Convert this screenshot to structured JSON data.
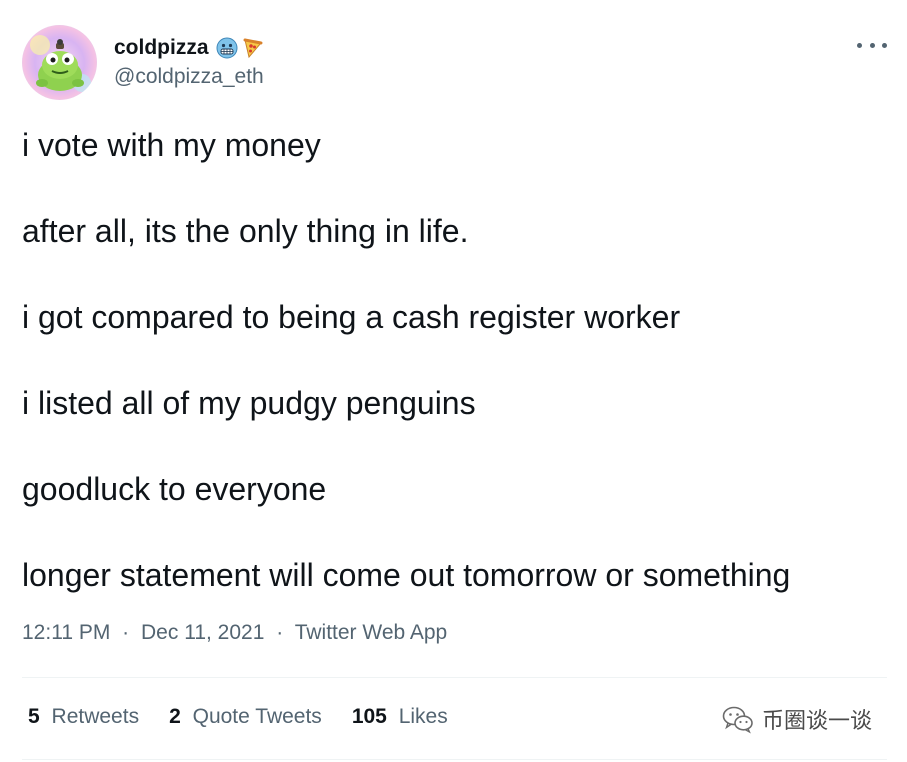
{
  "tweet": {
    "author": {
      "display_name": "coldpizza",
      "handle": "@coldpizza_eth",
      "avatar": "green-frog-character-avatar",
      "name_emojis": [
        "grimacing-cold-face-emoji",
        "pizza-emoji"
      ]
    },
    "more_icon": "ellipsis-icon",
    "lines": [
      "i vote with my money",
      "after all, its the only thing in life.",
      "i got compared to being a cash register worker",
      "i listed all of my pudgy penguins",
      "goodluck to everyone",
      "longer statement will come out tomorrow or something"
    ],
    "time": "12:11 PM",
    "separator": "·",
    "date": "Dec 11, 2021",
    "source": "Twitter Web App",
    "stats": {
      "retweets_count": "5",
      "retweets_label": "Retweets",
      "quotes_count": "2",
      "quotes_label": "Quote Tweets",
      "likes_count": "105",
      "likes_label": "Likes"
    }
  },
  "watermark": {
    "icon": "wechat-icon",
    "text": "币圈谈一谈"
  },
  "colors": {
    "text_primary": "#0f1419",
    "text_secondary": "#536471",
    "divider": "#eff3f4",
    "background": "#ffffff"
  }
}
